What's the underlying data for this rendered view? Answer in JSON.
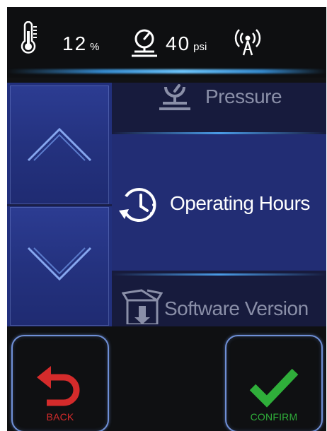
{
  "status": {
    "humidity": {
      "value": "12",
      "unit": "%"
    },
    "pressure": {
      "value": "40",
      "unit": "psi"
    },
    "icons": [
      "thermometer-icon",
      "pressure-gauge-icon",
      "wireless-signal-icon"
    ]
  },
  "menu": {
    "items": [
      {
        "label": "Pressure",
        "icon": "pressure-gauge-icon"
      },
      {
        "label": "Operating Hours",
        "icon": "clock-history-icon"
      },
      {
        "label": "Software Version",
        "icon": "software-box-icon"
      }
    ],
    "selected": "Operating Hours"
  },
  "buttons": {
    "back": {
      "label": "BACK",
      "icon": "back-arrow-icon",
      "color": "#d42b2b"
    },
    "confirm": {
      "label": "CONFIRM",
      "icon": "checkmark-icon",
      "color": "#2fae3a"
    }
  },
  "colors": {
    "accent_blue": "#6f8fd6",
    "panel_dark": "#0e0f11",
    "menu_selected": "#222d74"
  }
}
